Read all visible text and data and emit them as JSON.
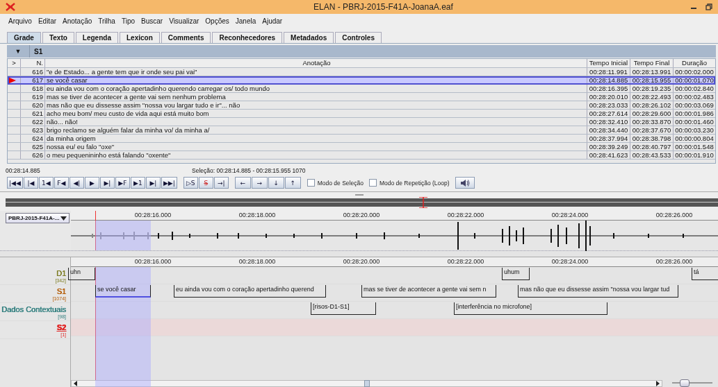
{
  "window": {
    "title": "ELAN - PBRJ-2015-F41A-JoanaA.eaf"
  },
  "menu": [
    "Arquivo",
    "Editar",
    "Anotação",
    "Trilha",
    "Tipo",
    "Buscar",
    "Visualizar",
    "Opções",
    "Janela",
    "Ajudar"
  ],
  "tabs": [
    {
      "label": "Grade",
      "selected": true
    },
    {
      "label": "Texto",
      "selected": false
    },
    {
      "label": "Legenda",
      "selected": false
    },
    {
      "label": "Lexicon",
      "selected": false
    },
    {
      "label": "Comments",
      "selected": false
    },
    {
      "label": "Reconhecedores",
      "selected": false
    },
    {
      "label": "Metadados",
      "selected": false
    },
    {
      "label": "Controles",
      "selected": false
    }
  ],
  "tier_selector": {
    "toggle": "▼",
    "tier": "S1"
  },
  "table": {
    "columns": [
      ">",
      "N.",
      "Anotação",
      "Tempo Inicial",
      "Tempo Final",
      "Duração"
    ],
    "rows": [
      {
        "n": "616",
        "text": "\"e de Estado... a gente tem que ir onde seu pai vai\"",
        "begin": "00:28:11.991",
        "end": "00:28:13.991",
        "duration": "00:00:02.000",
        "selected": false
      },
      {
        "n": "617",
        "text": "se você casar",
        "begin": "00:28:14.885",
        "end": "00:28:15.955",
        "duration": "00:00:01.070",
        "selected": true
      },
      {
        "n": "618",
        "text": "eu ainda vou com o coração apertadinho querendo carregar os/ todo mundo",
        "begin": "00:28:16.395",
        "end": "00:28:19.235",
        "duration": "00:00:02.840",
        "selected": false
      },
      {
        "n": "619",
        "text": "mas se tiver de acontecer a gente vai sem nenhum problema",
        "begin": "00:28:20.010",
        "end": "00:28:22.493",
        "duration": "00:00:02.483",
        "selected": false
      },
      {
        "n": "620",
        "text": "mas não que eu dissesse assim \"nossa vou largar tudo e ir\"... não",
        "begin": "00:28:23.033",
        "end": "00:28:26.102",
        "duration": "00:00:03.069",
        "selected": false
      },
      {
        "n": "621",
        "text": "acho meu bom/ meu custo de vida aqui está muito bom",
        "begin": "00:28:27.614",
        "end": "00:28:29.600",
        "duration": "00:00:01.986",
        "selected": false
      },
      {
        "n": "622",
        "text": "não... não!",
        "begin": "00:28:32.410",
        "end": "00:28:33.870",
        "duration": "00:00:01.460",
        "selected": false
      },
      {
        "n": "623",
        "text": "brigo reclamo se alguém falar da minha vo/ da minha a/",
        "begin": "00:28:34.440",
        "end": "00:28:37.670",
        "duration": "00:00:03.230",
        "selected": false
      },
      {
        "n": "624",
        "text": "da minha origem",
        "begin": "00:28:37.994",
        "end": "00:28:38.798",
        "duration": "00:00:00.804",
        "selected": false
      },
      {
        "n": "625",
        "text": "nossa eu/ eu falo \"oxe\"",
        "begin": "00:28:39.249",
        "end": "00:28:40.797",
        "duration": "00:00:01.548",
        "selected": false
      },
      {
        "n": "626",
        "text": "o meu pequenininho está falando \"oxente\"",
        "begin": "00:28:41.623",
        "end": "00:28:43.533",
        "duration": "00:00:01.910",
        "selected": false
      }
    ]
  },
  "controls": {
    "time": "00:28:14.885",
    "selection": "Seleção: 00:28:14.885 - 00:28:15.955  1070",
    "transport": [
      "|◀◀",
      "|◀",
      "1◀",
      "F◀",
      "◀|",
      "▶",
      "▶|",
      "▶F",
      "▶1",
      "▶|",
      "▶▶|"
    ],
    "selection_buttons": [
      "▷S",
      "S",
      "→|"
    ],
    "arrows": [
      "←",
      "→",
      "↓",
      "↑"
    ],
    "checkboxes": [
      {
        "label": "Modo de Seleção",
        "checked": false
      },
      {
        "label": "Modo de Repetição (Loop)",
        "checked": false
      }
    ]
  },
  "waveform": {
    "media": "PBRJ-2015-F41A-...",
    "ruler": [
      "00:28:16.000",
      "00:28:18.000",
      "00:28:20.000",
      "00:28:22.000",
      "00:28:24.000",
      "00:28:26.000"
    ]
  },
  "timeline": {
    "ruler": [
      "00:28:16.000",
      "00:28:18.000",
      "00:28:20.000",
      "00:28:22.000",
      "00:28:24.000",
      "00:28:26.000"
    ],
    "tiers": [
      {
        "name": "D1",
        "count": "[342]",
        "color": "#7a7a1e",
        "selected": false,
        "annotations": [
          "uhn",
          "uhum",
          "tá"
        ]
      },
      {
        "name": "S1",
        "count": "[1074]",
        "color": "#b35900",
        "selected": false,
        "annotations": [
          "se você casar",
          "eu ainda vou com o coração apertadinho querend",
          "mas se tiver de acontecer a gente vai sem n",
          "mas não que eu dissesse assim \"nossa vou largar tud"
        ]
      },
      {
        "name": "Dados Contextuais",
        "count": "[98]",
        "color": "#2e7d7d",
        "selected": false,
        "annotations": [
          "[risos-D1-S1]",
          "[interferência no microfone]"
        ]
      },
      {
        "name": "S2",
        "count": "[1]",
        "color": "#e02020",
        "selected": true
      }
    ]
  },
  "zoom_slider": {
    "level": 0.3
  }
}
